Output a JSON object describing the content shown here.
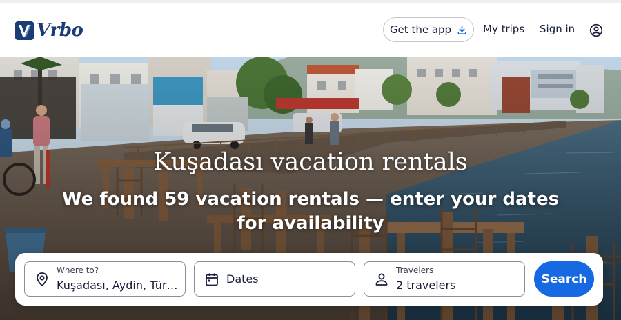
{
  "brand": {
    "name": "Vrbo",
    "color": "#1b3d73"
  },
  "header": {
    "get_app_label": "Get the app",
    "my_trips_label": "My trips",
    "sign_in_label": "Sign in",
    "account_icon": "account-circle-icon"
  },
  "hero": {
    "title": "Kuşadası vacation rentals",
    "subtitle": "We found 59 vacation rentals — enter your dates for availability"
  },
  "search": {
    "where": {
      "label": "Where to?",
      "value": "Kuşadası, Aydin, Türkiye",
      "icon": "location-pin-icon"
    },
    "dates": {
      "label": "Dates",
      "icon": "calendar-icon"
    },
    "travelers": {
      "label": "Travelers",
      "value": "2 travelers",
      "icon": "person-icon"
    },
    "button_label": "Search",
    "accent": "#1668e3"
  }
}
